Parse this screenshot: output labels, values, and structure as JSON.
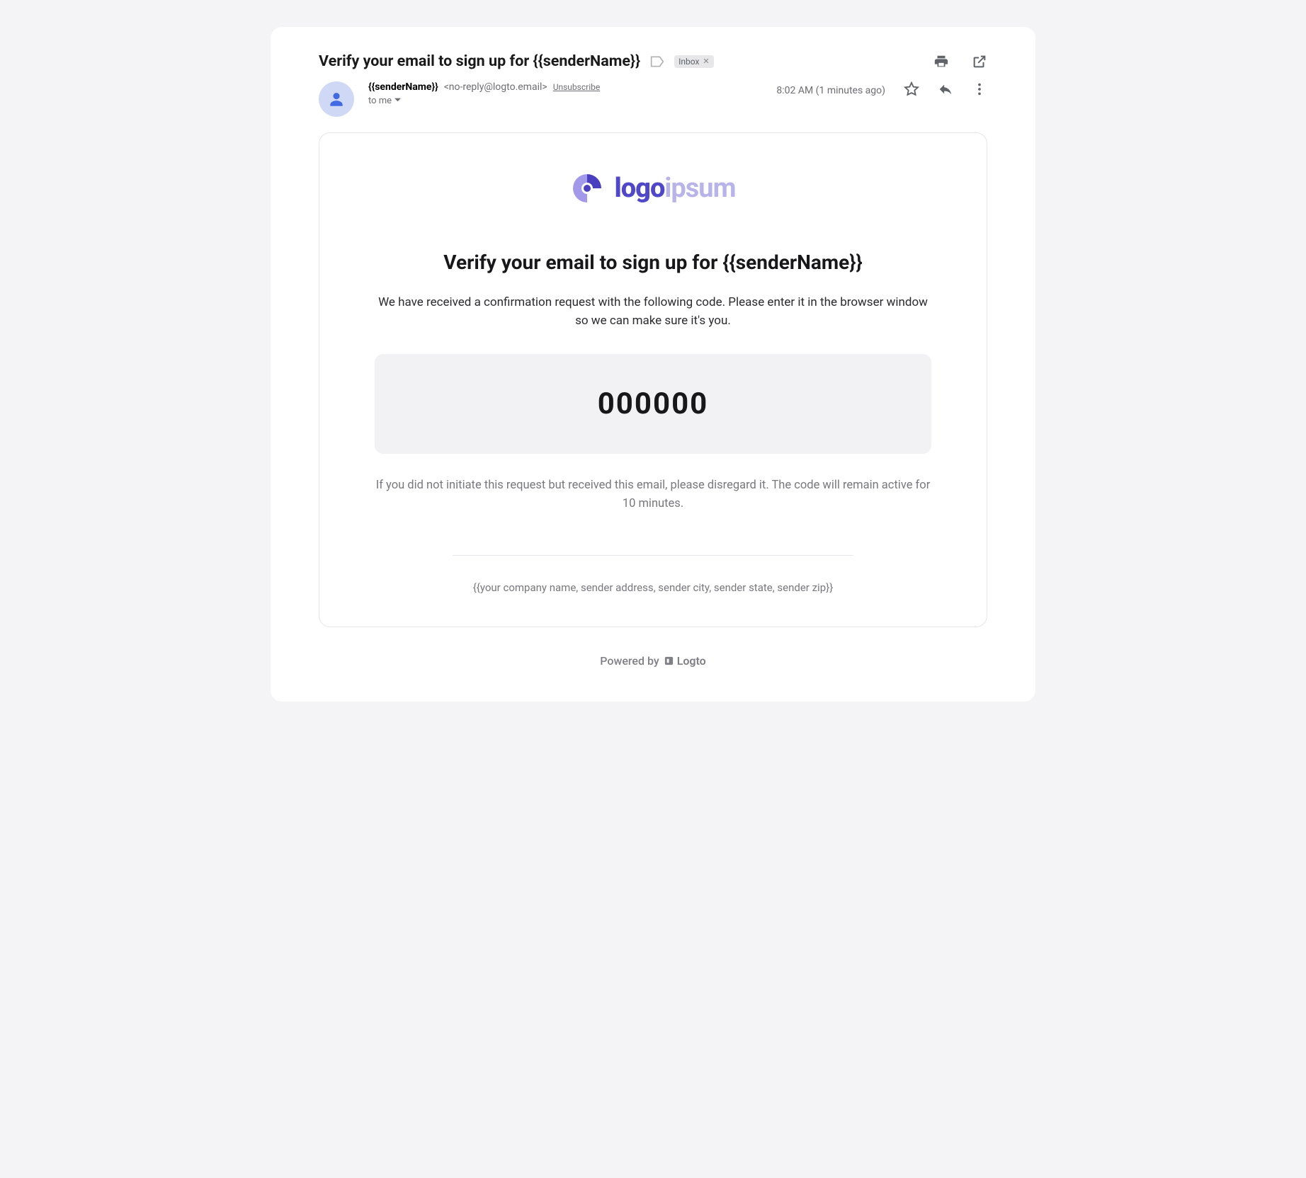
{
  "header": {
    "subject": "Verify your email to sign up for {{senderName}}",
    "label": "Inbox"
  },
  "sender": {
    "name": "{{senderName}}",
    "email": "<no-reply@logto.email>",
    "unsubscribe": "Unsubscribe",
    "to_line": "to me",
    "timestamp": "8:02 AM (1 minutes ago)"
  },
  "card": {
    "logo_dark": "logo",
    "logo_light": "ipsum",
    "title": "Verify your email to sign up for {{senderName}}",
    "body": "We have received a confirmation request with the following code. Please enter it in the browser window so we can make sure it's you.",
    "code": "000000",
    "disclaimer": "If you did not initiate this request but received this email, please disregard it. The code will remain active for 10 minutes.",
    "company_footer": "{{your company name, sender address, sender city, sender state, sender zip}}"
  },
  "powered": {
    "prefix": "Powered by",
    "brand": "Logto"
  }
}
